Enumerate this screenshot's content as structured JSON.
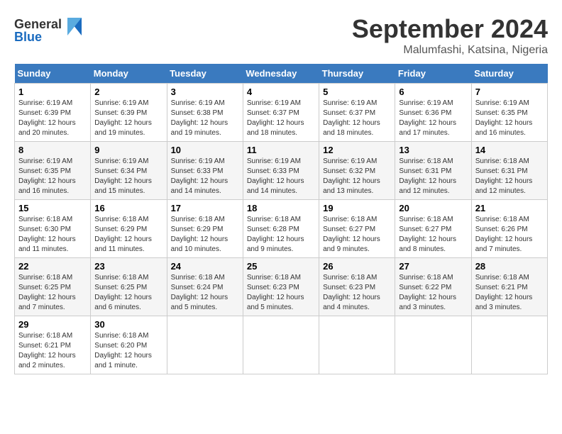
{
  "header": {
    "logo_line1": "General",
    "logo_line2": "Blue",
    "month": "September 2024",
    "location": "Malumfashi, Katsina, Nigeria"
  },
  "weekdays": [
    "Sunday",
    "Monday",
    "Tuesday",
    "Wednesday",
    "Thursday",
    "Friday",
    "Saturday"
  ],
  "weeks": [
    [
      {
        "day": "1",
        "info": "Sunrise: 6:19 AM\nSunset: 6:39 PM\nDaylight: 12 hours\nand 20 minutes."
      },
      {
        "day": "2",
        "info": "Sunrise: 6:19 AM\nSunset: 6:39 PM\nDaylight: 12 hours\nand 19 minutes."
      },
      {
        "day": "3",
        "info": "Sunrise: 6:19 AM\nSunset: 6:38 PM\nDaylight: 12 hours\nand 19 minutes."
      },
      {
        "day": "4",
        "info": "Sunrise: 6:19 AM\nSunset: 6:37 PM\nDaylight: 12 hours\nand 18 minutes."
      },
      {
        "day": "5",
        "info": "Sunrise: 6:19 AM\nSunset: 6:37 PM\nDaylight: 12 hours\nand 18 minutes."
      },
      {
        "day": "6",
        "info": "Sunrise: 6:19 AM\nSunset: 6:36 PM\nDaylight: 12 hours\nand 17 minutes."
      },
      {
        "day": "7",
        "info": "Sunrise: 6:19 AM\nSunset: 6:35 PM\nDaylight: 12 hours\nand 16 minutes."
      }
    ],
    [
      {
        "day": "8",
        "info": "Sunrise: 6:19 AM\nSunset: 6:35 PM\nDaylight: 12 hours\nand 16 minutes."
      },
      {
        "day": "9",
        "info": "Sunrise: 6:19 AM\nSunset: 6:34 PM\nDaylight: 12 hours\nand 15 minutes."
      },
      {
        "day": "10",
        "info": "Sunrise: 6:19 AM\nSunset: 6:33 PM\nDaylight: 12 hours\nand 14 minutes."
      },
      {
        "day": "11",
        "info": "Sunrise: 6:19 AM\nSunset: 6:33 PM\nDaylight: 12 hours\nand 14 minutes."
      },
      {
        "day": "12",
        "info": "Sunrise: 6:19 AM\nSunset: 6:32 PM\nDaylight: 12 hours\nand 13 minutes."
      },
      {
        "day": "13",
        "info": "Sunrise: 6:18 AM\nSunset: 6:31 PM\nDaylight: 12 hours\nand 12 minutes."
      },
      {
        "day": "14",
        "info": "Sunrise: 6:18 AM\nSunset: 6:31 PM\nDaylight: 12 hours\nand 12 minutes."
      }
    ],
    [
      {
        "day": "15",
        "info": "Sunrise: 6:18 AM\nSunset: 6:30 PM\nDaylight: 12 hours\nand 11 minutes."
      },
      {
        "day": "16",
        "info": "Sunrise: 6:18 AM\nSunset: 6:29 PM\nDaylight: 12 hours\nand 11 minutes."
      },
      {
        "day": "17",
        "info": "Sunrise: 6:18 AM\nSunset: 6:29 PM\nDaylight: 12 hours\nand 10 minutes."
      },
      {
        "day": "18",
        "info": "Sunrise: 6:18 AM\nSunset: 6:28 PM\nDaylight: 12 hours\nand 9 minutes."
      },
      {
        "day": "19",
        "info": "Sunrise: 6:18 AM\nSunset: 6:27 PM\nDaylight: 12 hours\nand 9 minutes."
      },
      {
        "day": "20",
        "info": "Sunrise: 6:18 AM\nSunset: 6:27 PM\nDaylight: 12 hours\nand 8 minutes."
      },
      {
        "day": "21",
        "info": "Sunrise: 6:18 AM\nSunset: 6:26 PM\nDaylight: 12 hours\nand 7 minutes."
      }
    ],
    [
      {
        "day": "22",
        "info": "Sunrise: 6:18 AM\nSunset: 6:25 PM\nDaylight: 12 hours\nand 7 minutes."
      },
      {
        "day": "23",
        "info": "Sunrise: 6:18 AM\nSunset: 6:25 PM\nDaylight: 12 hours\nand 6 minutes."
      },
      {
        "day": "24",
        "info": "Sunrise: 6:18 AM\nSunset: 6:24 PM\nDaylight: 12 hours\nand 5 minutes."
      },
      {
        "day": "25",
        "info": "Sunrise: 6:18 AM\nSunset: 6:23 PM\nDaylight: 12 hours\nand 5 minutes."
      },
      {
        "day": "26",
        "info": "Sunrise: 6:18 AM\nSunset: 6:23 PM\nDaylight: 12 hours\nand 4 minutes."
      },
      {
        "day": "27",
        "info": "Sunrise: 6:18 AM\nSunset: 6:22 PM\nDaylight: 12 hours\nand 3 minutes."
      },
      {
        "day": "28",
        "info": "Sunrise: 6:18 AM\nSunset: 6:21 PM\nDaylight: 12 hours\nand 3 minutes."
      }
    ],
    [
      {
        "day": "29",
        "info": "Sunrise: 6:18 AM\nSunset: 6:21 PM\nDaylight: 12 hours\nand 2 minutes."
      },
      {
        "day": "30",
        "info": "Sunrise: 6:18 AM\nSunset: 6:20 PM\nDaylight: 12 hours\nand 1 minute."
      },
      null,
      null,
      null,
      null,
      null
    ]
  ]
}
